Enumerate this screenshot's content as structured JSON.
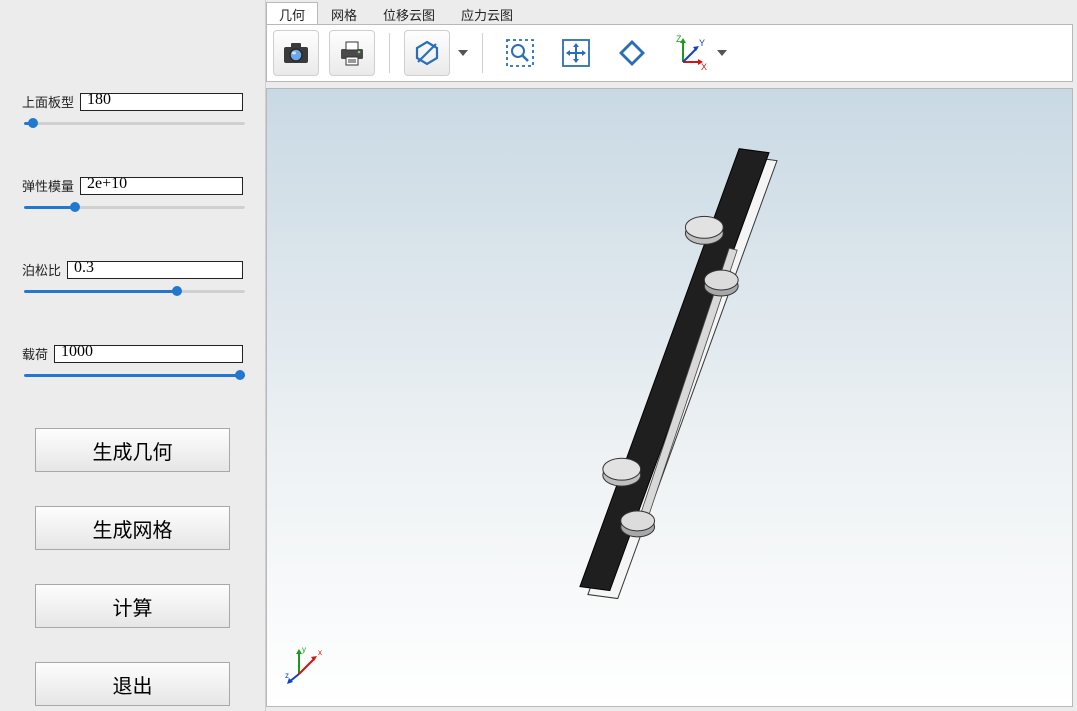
{
  "sidebar": {
    "params": [
      {
        "label": "上面板型",
        "value": "180",
        "slider_pct": 2
      },
      {
        "label": "弹性模量",
        "value": "2e+10",
        "slider_pct": 22
      },
      {
        "label": "泊松比",
        "value": "0.3",
        "slider_pct": 70
      },
      {
        "label": "载荷",
        "value": "1000",
        "slider_pct": 100
      }
    ],
    "buttons": {
      "generate_geometry": "生成几何",
      "generate_mesh": "生成网格",
      "compute": "计算",
      "exit": "退出"
    }
  },
  "tabs": [
    {
      "label": "几何",
      "active": true
    },
    {
      "label": "网格",
      "active": false
    },
    {
      "label": "位移云图",
      "active": false
    },
    {
      "label": "应力云图",
      "active": false
    }
  ],
  "toolbar": {
    "screenshot_icon": "camera-icon",
    "print_icon": "printer-icon",
    "shading_icon": "hexagon-slash-icon",
    "zoom_box_icon": "zoom-box-icon",
    "fit_icon": "fit-view-icon",
    "rotate_icon": "rotate-diamond-icon",
    "axes_icon": "axes-icon",
    "axes_labels": {
      "x": "X",
      "y": "Y",
      "z": "Z"
    }
  },
  "canvas": {
    "triad_labels": {
      "x": "x",
      "y": "y",
      "z": "z"
    }
  }
}
